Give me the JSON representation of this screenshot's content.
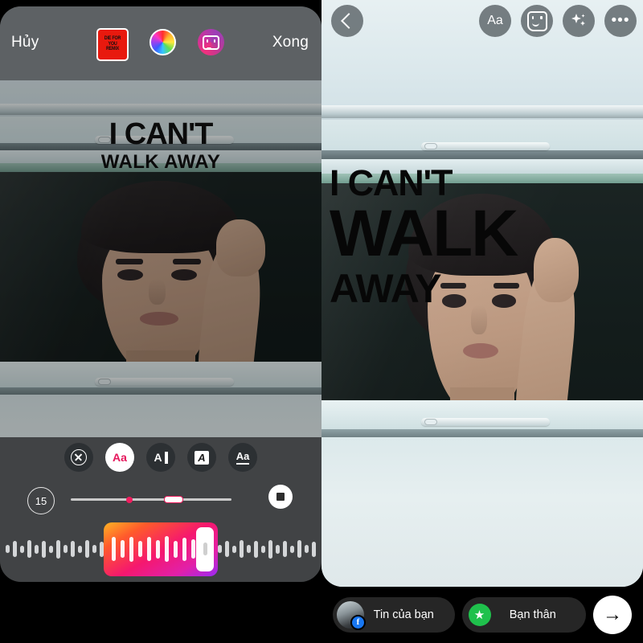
{
  "editor": {
    "cancel_label": "Hủy",
    "done_label": "Xong",
    "album_art": {
      "name": "die-for-you-remix-cover",
      "line1": "DIE FOR",
      "line2": "YOU",
      "line3": "REMIX",
      "background": "#e8190e"
    },
    "color_picker_icon": "color-wheel-icon",
    "chat_icon": "chat-bubble-icon",
    "overlay_text": {
      "line1": "I CAN'T",
      "line2": "WALK AWAY"
    },
    "text_tools": [
      {
        "name": "clear-text-button",
        "glyph": "close-circle",
        "label": "",
        "active": false
      },
      {
        "name": "font-style-button",
        "glyph": "Aa",
        "label": "Aa",
        "active": true
      },
      {
        "name": "text-align-button",
        "glyph": "A-bar",
        "label": "A",
        "active": false
      },
      {
        "name": "text-highlight-button",
        "glyph": "A-box",
        "label": "A",
        "active": false
      },
      {
        "name": "text-underline-button",
        "glyph": "Aa-underline",
        "label": "Aa",
        "active": false
      }
    ],
    "duration": {
      "value": "15",
      "unit_label": ""
    },
    "stop_button": "stop-button",
    "accent_color": "#ef1d5e",
    "waveform": {
      "selection_bars": 11,
      "left_bars": 14,
      "right_bars": 14,
      "gradient_from": "#ffb524",
      "gradient_to": "#9b2bf5"
    }
  },
  "preview": {
    "back_button": "back-button",
    "tools": [
      {
        "name": "text-tool-button",
        "label": "Aa"
      },
      {
        "name": "sticker-tool-button",
        "label": ""
      },
      {
        "name": "effects-tool-button",
        "label": ""
      },
      {
        "name": "more-options-button",
        "label": "•••"
      }
    ],
    "story_text": {
      "line1": "I CAN'T",
      "line2": "WALK",
      "line3": "AWAY"
    },
    "share": {
      "your_story_label": "Tin của bạn",
      "close_friends_label": "Bạn thân",
      "close_friends_color": "#1fc14c",
      "send_button": "send-button",
      "send_glyph": "→"
    }
  }
}
